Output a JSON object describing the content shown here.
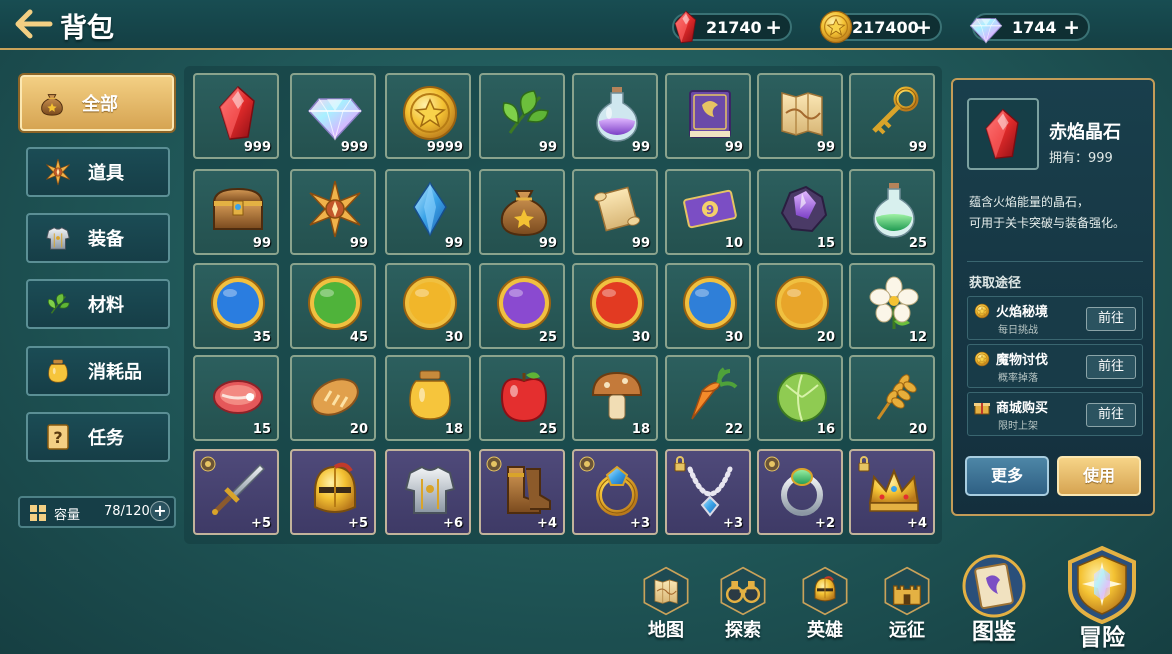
{
  "header": {
    "title": "背包"
  },
  "currencies": [
    {
      "icon": "ruby-icon",
      "value": "21740",
      "plus": "+"
    },
    {
      "icon": "gold-coin-icon",
      "value": "217400",
      "plus": "+"
    },
    {
      "icon": "diamond-icon",
      "value": "1744",
      "plus": "+"
    }
  ],
  "sidebar": {
    "items": [
      {
        "label": "全部",
        "icon": "bag-icon",
        "active": true
      },
      {
        "label": "道具",
        "icon": "tool-icon",
        "active": false
      },
      {
        "label": "装备",
        "icon": "armor-icon",
        "active": false
      },
      {
        "label": "材料",
        "icon": "material-icon",
        "active": false
      },
      {
        "label": "消耗品",
        "icon": "potion-icon",
        "active": false
      },
      {
        "label": "任务",
        "icon": "quest-icon",
        "active": false
      }
    ],
    "capacity": {
      "label": "容量",
      "value": "78/120",
      "plus": "+"
    }
  },
  "inventory": {
    "rows": [
      [
        {
          "icon": "red-crystal-icon",
          "count": "999"
        },
        {
          "icon": "rainbow-diamond-icon",
          "count": "999"
        },
        {
          "icon": "gold-star-coin-icon",
          "count": "9999"
        },
        {
          "icon": "leaf-icon",
          "count": "99"
        },
        {
          "icon": "purple-potion-icon",
          "count": "99"
        },
        {
          "icon": "spell-book-icon",
          "count": "99"
        },
        {
          "icon": "map-scroll-icon",
          "count": "99"
        },
        {
          "icon": "gold-key-icon",
          "count": "99"
        }
      ],
      [
        {
          "icon": "treasure-chest-icon",
          "count": "99"
        },
        {
          "icon": "compass-star-icon",
          "count": "99"
        },
        {
          "icon": "blue-crystal-icon",
          "count": "99"
        },
        {
          "icon": "money-bag-icon",
          "count": "99"
        },
        {
          "icon": "parchment-scroll-icon",
          "count": "99"
        },
        {
          "icon": "magic-ticket-icon",
          "count": "10"
        },
        {
          "icon": "purple-ore-icon",
          "count": "15"
        },
        {
          "icon": "green-potion-icon",
          "count": "25"
        }
      ],
      [
        {
          "icon": "water-orb-icon",
          "count": "35"
        },
        {
          "icon": "nature-orb-icon",
          "count": "45"
        },
        {
          "icon": "lightning-orb-icon",
          "count": "30"
        },
        {
          "icon": "vortex-orb-icon",
          "count": "25"
        },
        {
          "icon": "fire-orb-icon",
          "count": "30"
        },
        {
          "icon": "frost-orb-icon",
          "count": "30"
        },
        {
          "icon": "wing-orb-icon",
          "count": "20"
        },
        {
          "icon": "white-flower-icon",
          "count": "12"
        }
      ],
      [
        {
          "icon": "raw-meat-icon",
          "count": "15"
        },
        {
          "icon": "bread-icon",
          "count": "20"
        },
        {
          "icon": "honey-jar-icon",
          "count": "18"
        },
        {
          "icon": "apple-icon",
          "count": "25"
        },
        {
          "icon": "mushroom-icon",
          "count": "18"
        },
        {
          "icon": "carrot-icon",
          "count": "22"
        },
        {
          "icon": "cabbage-icon",
          "count": "16"
        },
        {
          "icon": "wheat-icon",
          "count": "20"
        }
      ],
      [
        {
          "icon": "sword-icon",
          "count": "+5",
          "mark": "lock-badge-icon"
        },
        {
          "icon": "knight-helmet-icon",
          "count": "+5",
          "mark": ""
        },
        {
          "icon": "chest-armor-icon",
          "count": "+6",
          "mark": ""
        },
        {
          "icon": "leather-boots-icon",
          "count": "+4",
          "mark": "lock-badge-icon"
        },
        {
          "icon": "sapphire-ring-icon",
          "count": "+3",
          "mark": "lock-badge-icon"
        },
        {
          "icon": "pearl-necklace-icon",
          "count": "+3",
          "mark": "lock-icon"
        },
        {
          "icon": "emerald-ring-icon",
          "count": "+2",
          "mark": "lock-badge-icon"
        },
        {
          "icon": "gold-crown-icon",
          "count": "+4",
          "mark": "lock-icon"
        }
      ]
    ]
  },
  "detail": {
    "icon": "red-crystal-icon",
    "name": "赤焰晶石",
    "owned": "拥有：999",
    "desc1": "蕴含火焰能量的晶石，",
    "desc2": "可用于关卡突破与装备强化。",
    "routes_title": "获取途径",
    "routes": [
      {
        "icon": "coin-shield-icon",
        "title": "火焰秘境",
        "sub": "每日挑战",
        "button": "前往"
      },
      {
        "icon": "coin-shield-icon",
        "title": "魔物讨伐",
        "sub": "概率掉落",
        "button": "前往"
      },
      {
        "icon": "gift-icon",
        "title": "商城购买",
        "sub": "限时上架",
        "button": "前往"
      }
    ],
    "more_label": "更多",
    "use_label": "使用"
  },
  "bottom_nav": [
    {
      "label": "地图",
      "icon": "map-icon"
    },
    {
      "label": "探索",
      "icon": "binoculars-icon"
    },
    {
      "label": "英雄",
      "icon": "hero-helmet-icon"
    },
    {
      "label": "远征",
      "icon": "castle-icon"
    },
    {
      "label": "图鉴",
      "icon": "codex-icon"
    },
    {
      "label": "冒险",
      "icon": "adventure-crest-icon"
    }
  ],
  "colors": {
    "gold": "#d6a452",
    "panel": "#163e47",
    "slot": "#2c5f5e",
    "equip_slot": "#4f4a7a",
    "accent_blue": "#3c6f8c"
  }
}
